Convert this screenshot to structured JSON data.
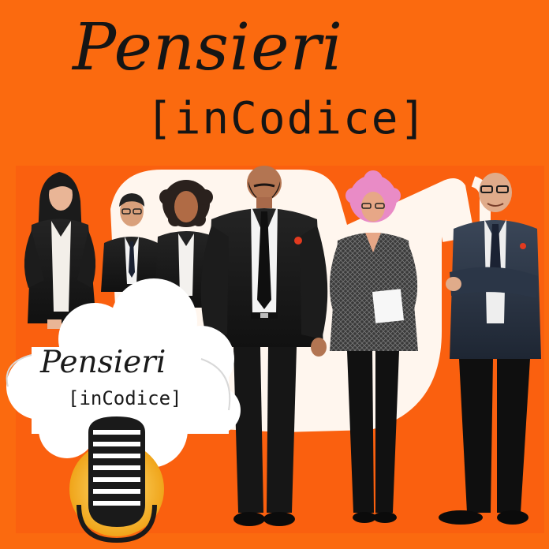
{
  "title": {
    "line1": "Pensieri",
    "line2": "[inCodice]"
  },
  "logo": {
    "line1": "Pensieri",
    "line2": "[inCodice]",
    "icon": "microphone-icon"
  },
  "scene": {
    "description_icon": "team-illustration",
    "people_count": 6
  },
  "colors": {
    "background": "#fb6a0f",
    "panel": "#fff6ee",
    "ink": "#151515",
    "mic_gold": "#f6c534"
  }
}
